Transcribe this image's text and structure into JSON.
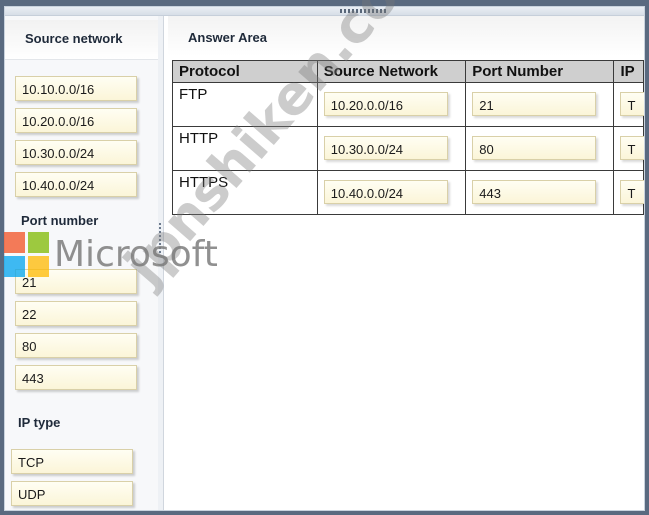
{
  "left_pane": {
    "title": "Source network",
    "source_networks": [
      "10.10.0.0/16",
      "10.20.0.0/16",
      "10.30.0.0/24",
      "10.40.0.0/24"
    ],
    "port_heading": "Port number",
    "ports": [
      "21",
      "22",
      "80",
      "443"
    ],
    "ip_heading": "IP type",
    "ip_types": [
      "TCP",
      "UDP"
    ]
  },
  "answer_area": {
    "title": "Answer Area",
    "columns": [
      "Protocol",
      "Source Network",
      "Port Number",
      "IP"
    ],
    "rows": [
      {
        "protocol": "FTP",
        "source_network": "10.20.0.0/16",
        "port_number": "21",
        "ip": "T"
      },
      {
        "protocol": "HTTP",
        "source_network": "10.30.0.0/24",
        "port_number": "80",
        "ip": "T"
      },
      {
        "protocol": "HTTPS",
        "source_network": "10.40.0.0/24",
        "port_number": "443",
        "ip": "T"
      }
    ]
  },
  "overlays": {
    "brand_name": "Microsoft",
    "watermark": "jpnshiken.com",
    "logo_colors": [
      "#f25022",
      "#7fba00",
      "#00a4ef",
      "#ffb900"
    ]
  }
}
